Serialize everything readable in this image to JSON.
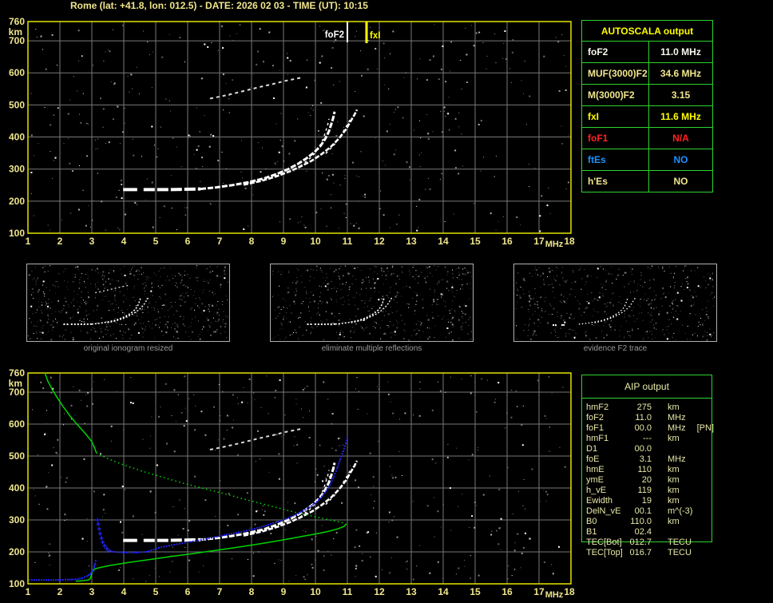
{
  "window": {
    "title": "Rome (lat: +41.8, lon: 012.5) - DATE: 2026 02 03 - TIME (UT): 10:15"
  },
  "colors": {
    "background": "#000000",
    "title_text": "#f0e68c",
    "axis_text": "#f0e68c",
    "plot_border": "#e3e300",
    "grid": "#787878",
    "table_border": "#2ed32e",
    "trace_white": "#ffffff",
    "multiple_gray": "#dcdcdc",
    "profile_green": "#00d400",
    "restored_blue": "#2222ee",
    "caption_gray": "#9a9a9a",
    "aip_text": "#e8e8a8",
    "autoscala_header": "#ffff00",
    "fof2_marker": "#ffffff",
    "fxi_marker": "#ffff00"
  },
  "autoscala_table": {
    "title": "AUTOSCALA output",
    "rows": [
      {
        "label": "foF2",
        "value": "11.0 MHz",
        "color": "#f8f8ee"
      },
      {
        "label": "MUF(3000)F2",
        "value": "34.6 MHz",
        "color": "#f0e68c"
      },
      {
        "label": "M(3000)F2",
        "value": "3.15",
        "color": "#f0e68c"
      },
      {
        "label": "fxI",
        "value": "11.6 MHz",
        "color": "#ffff00"
      },
      {
        "label": "foF1",
        "value": "N/A",
        "color": "#ff2222"
      },
      {
        "label": "ftEs",
        "value": "NO",
        "color": "#1e90ff"
      },
      {
        "label": "h'Es",
        "value": "NO",
        "color": "#f0e68c"
      }
    ]
  },
  "aip_table": {
    "title": "AIP output",
    "rows": [
      {
        "label": "hmF2",
        "value": "275",
        "unit": "km",
        "extra": ""
      },
      {
        "label": "foF2",
        "value": "11.0",
        "unit": "MHz",
        "extra": ""
      },
      {
        "label": "foF1",
        "value": "00.0",
        "unit": "MHz",
        "extra": "[PN]"
      },
      {
        "label": "hmF1",
        "value": "---",
        "unit": "km",
        "extra": ""
      },
      {
        "label": "D1",
        "value": "00.0",
        "unit": "",
        "extra": ""
      },
      {
        "label": "foE",
        "value": "3.1",
        "unit": "MHz",
        "extra": ""
      },
      {
        "label": "hmE",
        "value": "110",
        "unit": "km",
        "extra": ""
      },
      {
        "label": "ymE",
        "value": "20",
        "unit": "km",
        "extra": ""
      },
      {
        "label": "h_vE",
        "value": "119",
        "unit": "km",
        "extra": ""
      },
      {
        "label": "Ewidth",
        "value": "19",
        "unit": "km",
        "extra": ""
      },
      {
        "label": "DelN_vE",
        "value": "00.1",
        "unit": "m^(-3)",
        "extra": ""
      },
      {
        "label": "B0",
        "value": "110.0",
        "unit": "km",
        "extra": ""
      },
      {
        "label": "B1",
        "value": "02.4",
        "unit": "",
        "extra": ""
      },
      {
        "label": "TEC[Bot]",
        "value": "012.7",
        "unit": "TECU",
        "extra": ""
      },
      {
        "label": "TEC[Top]",
        "value": "016.7",
        "unit": "TECU",
        "extra": ""
      }
    ]
  },
  "thumbnails": [
    {
      "caption": "original ionogram resized"
    },
    {
      "caption": "eliminate multiple reflections"
    },
    {
      "caption": "evidence F2 trace"
    }
  ],
  "chart_data": {
    "type": "scatter",
    "description": "Ionogram: virtual height (km) vs sounding frequency (MHz); top = scaled ionogram, bottom = ionogram with AIP electron-density profile (green) and restored trace (blue)",
    "x_axis": {
      "label": "MHz",
      "range": [
        1,
        18
      ],
      "ticks": [
        1,
        2,
        3,
        4,
        5,
        6,
        7,
        8,
        9,
        10,
        11,
        12,
        13,
        14,
        15,
        16,
        17,
        18
      ]
    },
    "y_axis": {
      "label": "km",
      "range": [
        100,
        760
      ],
      "ticks": [
        760,
        700,
        600,
        500,
        400,
        300,
        200,
        100
      ]
    },
    "markers": [
      {
        "name": "foF2",
        "freq": 11.0,
        "color": "#ffffff"
      },
      {
        "name": "fxI",
        "freq": 11.6,
        "color": "#ffff00"
      }
    ],
    "traces": {
      "f2_flat_a": [
        [
          3.98,
          236
        ],
        [
          4.42,
          236
        ]
      ],
      "f2_flat_b": [
        [
          4.62,
          236
        ],
        [
          5.4,
          236
        ],
        [
          6.4,
          238
        ]
      ],
      "f2_ordinary": [
        [
          6.4,
          238
        ],
        [
          6.9,
          243
        ],
        [
          7.4,
          250
        ],
        [
          7.9,
          259
        ],
        [
          8.4,
          271
        ],
        [
          8.8,
          285
        ],
        [
          9.15,
          300
        ],
        [
          9.45,
          316
        ],
        [
          9.7,
          332
        ],
        [
          9.95,
          351
        ],
        [
          10.15,
          371
        ],
        [
          10.3,
          393
        ],
        [
          10.42,
          417
        ],
        [
          10.5,
          441
        ],
        [
          10.56,
          461
        ],
        [
          10.6,
          479
        ]
      ],
      "f2_extraordinary": [
        [
          7.75,
          251
        ],
        [
          8.3,
          263
        ],
        [
          8.8,
          278
        ],
        [
          9.2,
          293
        ],
        [
          9.55,
          309
        ],
        [
          9.9,
          327
        ],
        [
          10.2,
          347
        ],
        [
          10.5,
          371
        ],
        [
          10.75,
          397
        ],
        [
          10.95,
          423
        ],
        [
          11.1,
          449
        ],
        [
          11.22,
          469
        ],
        [
          11.3,
          485
        ]
      ],
      "multiple_reflection": [
        [
          6.7,
          520
        ],
        [
          7.1,
          528
        ],
        [
          7.5,
          537
        ],
        [
          7.9,
          547
        ],
        [
          8.3,
          557
        ],
        [
          8.7,
          566
        ],
        [
          9.05,
          575
        ],
        [
          9.35,
          581
        ],
        [
          9.6,
          586
        ]
      ],
      "green_profile_topside": [
        [
          1.53,
          760
        ],
        [
          1.62,
          735
        ],
        [
          1.75,
          710
        ],
        [
          1.92,
          682
        ],
        [
          2.1,
          655
        ],
        [
          2.32,
          625
        ],
        [
          2.55,
          598
        ],
        [
          2.8,
          570
        ],
        [
          3.0,
          545
        ],
        [
          3.1,
          522
        ],
        [
          3.14,
          510
        ]
      ],
      "green_profile_dotted": [
        [
          3.14,
          510
        ],
        [
          3.5,
          492
        ],
        [
          4.0,
          472
        ],
        [
          4.6,
          452
        ],
        [
          5.2,
          434
        ],
        [
          5.9,
          414
        ],
        [
          6.6,
          396
        ],
        [
          7.3,
          378
        ],
        [
          8.0,
          359
        ],
        [
          8.7,
          341
        ],
        [
          9.4,
          323
        ],
        [
          10.0,
          310
        ],
        [
          10.5,
          299
        ],
        [
          10.9,
          290
        ]
      ],
      "green_profile_bottomside": [
        [
          10.97,
          288
        ],
        [
          10.9,
          280
        ],
        [
          10.7,
          272
        ],
        [
          10.4,
          264
        ],
        [
          10.0,
          256
        ],
        [
          9.5,
          247
        ],
        [
          8.9,
          236
        ],
        [
          8.3,
          226
        ],
        [
          7.6,
          215
        ],
        [
          6.9,
          205
        ],
        [
          6.2,
          195
        ],
        [
          5.5,
          186
        ],
        [
          4.8,
          176
        ],
        [
          4.15,
          167
        ],
        [
          3.6,
          158
        ],
        [
          3.25,
          151
        ],
        [
          3.1,
          147
        ],
        [
          3.02,
          138
        ],
        [
          2.98,
          126
        ],
        [
          2.95,
          116
        ],
        [
          2.88,
          112
        ],
        [
          2.72,
          110
        ],
        [
          2.5,
          108
        ]
      ],
      "blue_e_trace": [
        [
          1.05,
          112
        ],
        [
          1.35,
          112
        ],
        [
          1.65,
          112
        ],
        [
          1.95,
          112
        ],
        [
          2.25,
          113
        ],
        [
          2.5,
          114
        ],
        [
          2.7,
          118
        ],
        [
          2.85,
          124
        ],
        [
          2.95,
          131
        ],
        [
          3.02,
          140
        ],
        [
          3.07,
          152
        ],
        [
          3.1,
          163
        ],
        [
          3.12,
          172
        ]
      ],
      "blue_valley": [
        [
          3.18,
          300
        ],
        [
          3.2,
          287
        ],
        [
          3.23,
          272
        ],
        [
          3.26,
          257
        ],
        [
          3.3,
          243
        ],
        [
          3.34,
          230
        ],
        [
          3.4,
          219
        ],
        [
          3.47,
          210
        ],
        [
          3.55,
          203
        ]
      ],
      "blue_f_trace": [
        [
          3.55,
          202
        ],
        [
          3.8,
          199
        ],
        [
          4.1,
          198
        ],
        [
          4.4,
          198
        ],
        [
          4.7,
          200
        ],
        [
          5.1,
          213
        ],
        [
          5.5,
          221
        ],
        [
          6.0,
          230
        ],
        [
          6.5,
          239
        ],
        [
          7.0,
          249
        ],
        [
          7.6,
          261
        ],
        [
          8.1,
          272
        ],
        [
          8.6,
          287
        ],
        [
          9.0,
          300
        ],
        [
          9.4,
          317
        ],
        [
          9.75,
          335
        ],
        [
          10.05,
          357
        ],
        [
          10.3,
          385
        ],
        [
          10.45,
          410
        ],
        [
          10.58,
          436
        ],
        [
          10.68,
          462
        ],
        [
          10.78,
          490
        ],
        [
          10.87,
          515
        ],
        [
          10.95,
          540
        ],
        [
          11.0,
          558
        ]
      ]
    }
  }
}
